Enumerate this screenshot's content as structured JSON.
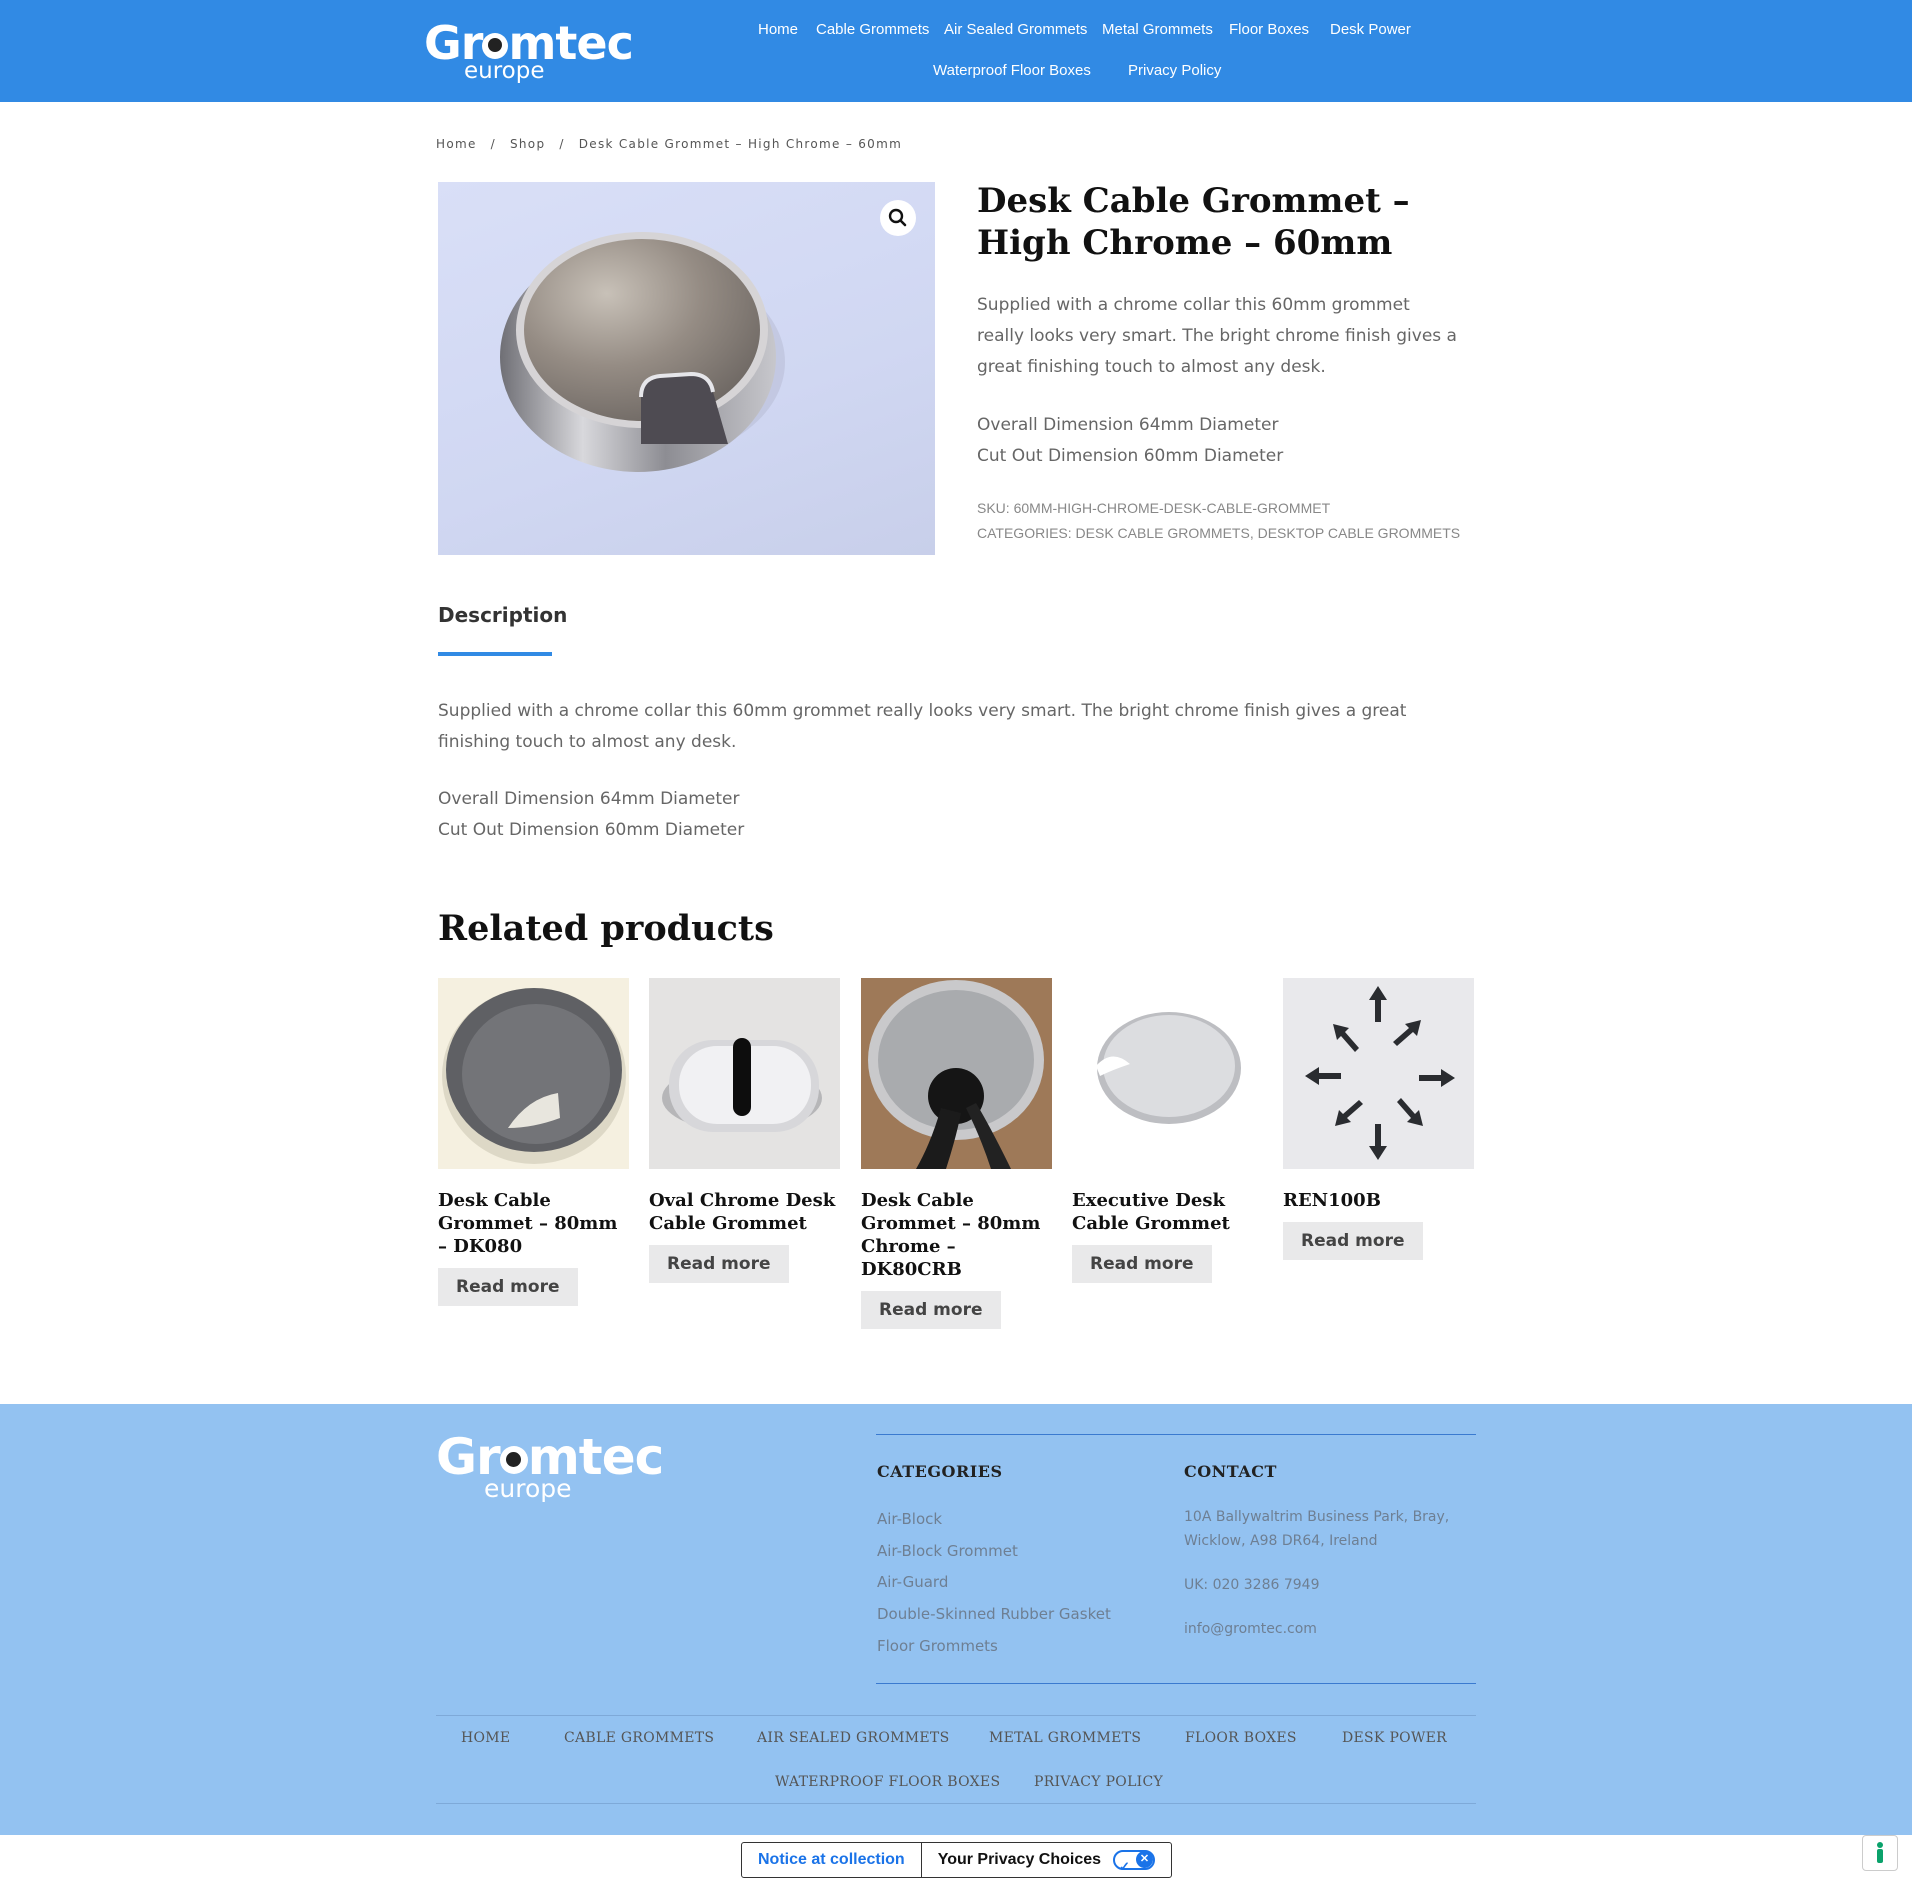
{
  "header": {
    "logo": {
      "word": "Gromtec",
      "sub": "europe"
    },
    "nav": [
      {
        "label": "Home"
      },
      {
        "label": "Cable Grommets"
      },
      {
        "label": "Air Sealed Grommets"
      },
      {
        "label": "Metal Grommets"
      },
      {
        "label": "Floor Boxes"
      },
      {
        "label": "Desk Power"
      },
      {
        "label": "Waterproof Floor Boxes"
      },
      {
        "label": "Privacy Policy"
      }
    ]
  },
  "breadcrumb": {
    "items": [
      "Home",
      "Shop",
      "Desk Cable Grommet – High Chrome – 60mm"
    ],
    "separator": "/"
  },
  "product": {
    "title": "Desk Cable Grommet – High Chrome – 60mm",
    "summary": "Supplied with a chrome collar this 60mm grommet really looks very smart. The bright chrome finish gives a great finishing touch to almost any desk.",
    "dim_overall": "Overall Dimension 64mm Diameter",
    "dim_cutout": "Cut Out Dimension 60mm Diameter",
    "sku_label": "SKU:",
    "sku": "60MM-HIGH-CHROME-DESK-CABLE-GROMMET",
    "categories_label": "CATEGORIES:",
    "categories": [
      "DESK CABLE GROMMETS",
      "DESKTOP CABLE GROMMETS"
    ],
    "categories_sep": ",",
    "zoom_icon": "magnifier-icon"
  },
  "tabs": {
    "description_label": "Description"
  },
  "description": {
    "text": "Supplied with a chrome collar this 60mm grommet really looks very smart. The bright chrome finish gives a great finishing touch to almost any desk.",
    "dim_overall": "Overall Dimension 64mm Diameter",
    "dim_cutout": "Cut Out Dimension 60mm Diameter"
  },
  "related": {
    "heading": "Related products",
    "items": [
      {
        "title": "Desk Cable Grommet – 80mm – DK080",
        "button": "Read more"
      },
      {
        "title": "Oval Chrome Desk Cable Grommet",
        "button": "Read more"
      },
      {
        "title": "Desk Cable Grommet – 80mm Chrome – DK80CRB",
        "button": "Read more"
      },
      {
        "title": "Executive Desk Cable Grommet",
        "button": "Read more"
      },
      {
        "title": "REN100B",
        "button": "Read more"
      }
    ]
  },
  "footer": {
    "logo": {
      "word": "Gromtec",
      "sub": "europe"
    },
    "categories_heading": "CATEGORIES",
    "categories": [
      "Air-Block",
      "Air-Block Grommet",
      "Air-Guard",
      "Double-Skinned Rubber Gasket",
      "Floor Grommets"
    ],
    "contact_heading": "CONTACT",
    "address_line1": "10A Ballywaltrim Business Park, Bray,",
    "address_line2": "Wicklow, A98 DR64, Ireland",
    "phone": "UK: 020 3286 7949",
    "email": "info@gromtec.com",
    "nav": [
      "HOME",
      "CABLE GROMMETS",
      "AIR SEALED GROMMETS",
      "METAL GROMMETS",
      "FLOOR BOXES",
      "DESK POWER",
      "WATERPROOF FLOOR BOXES",
      "PRIVACY POLICY"
    ]
  },
  "privacy_bar": {
    "notice": "Notice at collection",
    "choices": "Your Privacy Choices",
    "toggle_icon": "privacy-toggle-icon",
    "accessibility_icon": "accessibility-icon"
  },
  "colors": {
    "header_bg": "#318ae4",
    "footer_bg": "#93c2f1",
    "accent": "#318ae4",
    "button_bg": "#e9e9ea",
    "privacy_blue": "#1a73e8"
  }
}
